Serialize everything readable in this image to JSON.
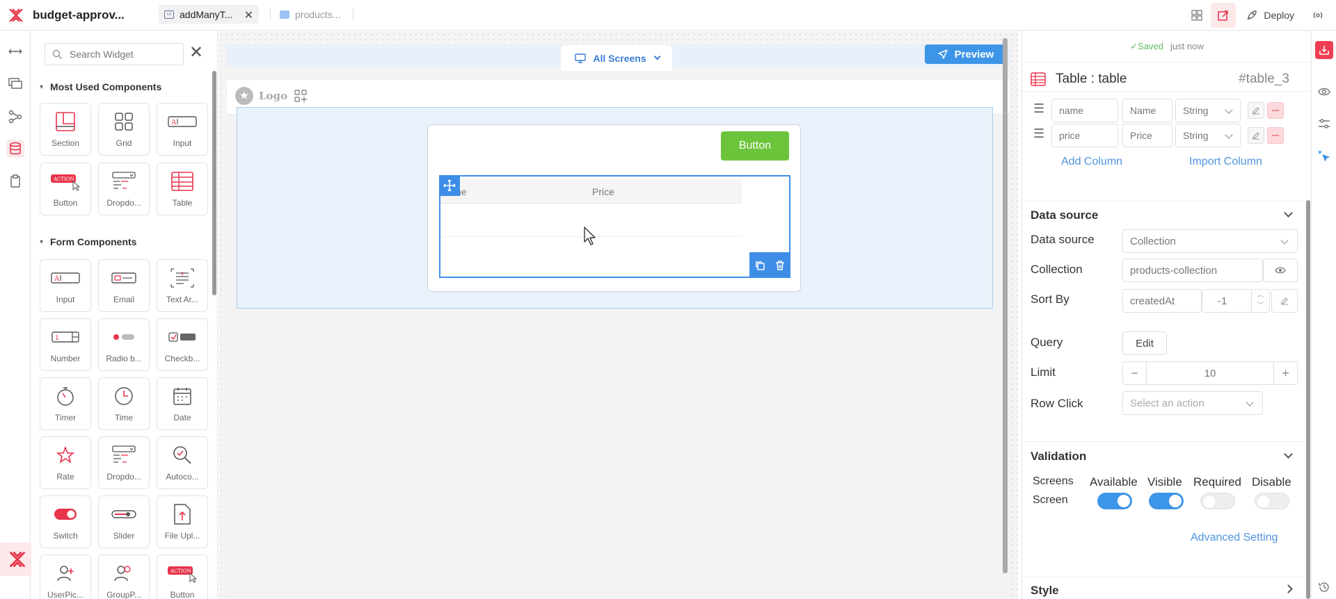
{
  "app": {
    "name": "budget-approv..."
  },
  "tabs": [
    {
      "label": "addManyT...",
      "icon": "ui-page-icon"
    },
    {
      "label": "products...",
      "icon": "database-icon"
    }
  ],
  "toolbar": {
    "deploy_label": "Deploy"
  },
  "widgets": {
    "search_placeholder": "Search Widget",
    "most_used": {
      "title": "Most Used Components",
      "items": [
        "Section",
        "Grid",
        "Input",
        "Button",
        "Dropdo...",
        "Table"
      ]
    },
    "form": {
      "title": "Form Components",
      "items": [
        "Input",
        "Email",
        "Text Ar...",
        "Number",
        "Radio b...",
        "Checkb...",
        "Timer",
        "Time",
        "Date",
        "Rate",
        "Dropdo...",
        "Autoco...",
        "Switch",
        "Slider",
        "File Upl...",
        "UserPic...",
        "GroupP...",
        "Button"
      ]
    },
    "action_badge": "ACTION"
  },
  "canvas": {
    "screens_label": "All Screens",
    "preview_label": "Preview",
    "logo_text": "Logo",
    "button_text": "Button",
    "table_headers": [
      "ne",
      "Price"
    ]
  },
  "props": {
    "saved": "Saved",
    "saved_time": "just now",
    "widget_title": "Table : table",
    "widget_id": "#table_3",
    "columns": [
      {
        "key": "name",
        "label": "Name",
        "type": "String"
      },
      {
        "key": "price",
        "label": "Price",
        "type": "String"
      }
    ],
    "add_column": "Add Column",
    "import_column": "Import Column",
    "data_source_section": "Data source",
    "data_source_label": "Data source",
    "data_source_value": "Collection",
    "collection_label": "Collection",
    "collection_value": "products-collection",
    "sort_label": "Sort By",
    "sort_field": "createdAt",
    "sort_order": "-1",
    "query_label": "Query",
    "edit_label": "Edit",
    "limit_label": "Limit",
    "limit_value": "10",
    "rowclick_label": "Row Click",
    "rowclick_placeholder": "Select an action",
    "validation_section": "Validation",
    "validation_headers": [
      "Screens",
      "Available",
      "Visible",
      "Required",
      "Disable"
    ],
    "validation_row": {
      "screen": "Screen",
      "available": true,
      "visible": true,
      "required": false,
      "disable": false
    },
    "advanced_setting": "Advanced Setting",
    "style_section": "Style"
  },
  "colors": {
    "brand": "#e8334a",
    "primary": "#3d95e8",
    "button_green": "#6cc43b"
  }
}
